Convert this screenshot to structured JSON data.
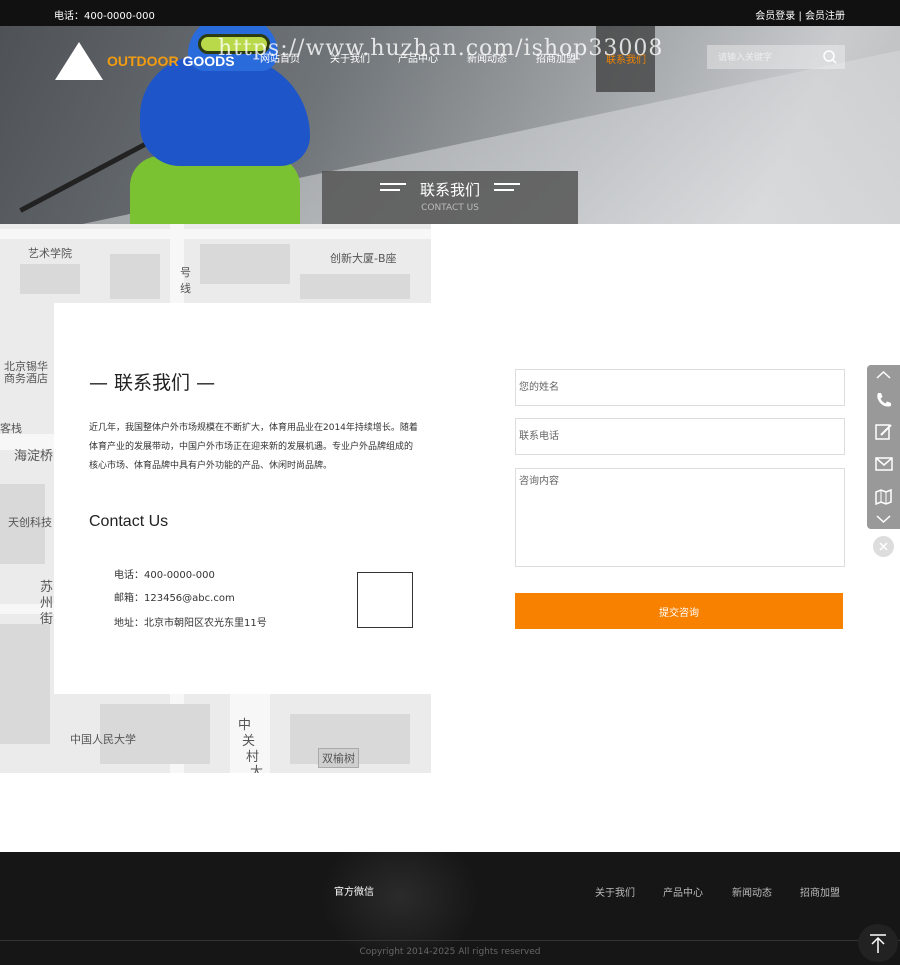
{
  "topbar": {
    "phone": "电话：400-0000-000",
    "login": "会员登录",
    "sep": "|",
    "register": "会员注册"
  },
  "brand": {
    "word1": "OUTDOOR",
    "word2": "GOODS"
  },
  "nav": {
    "items": [
      "网站首页",
      "关于我们",
      "产品中心",
      "新闻动态",
      "招商加盟"
    ],
    "active": "联系我们"
  },
  "watermark": "https://www.huzhan.com/ishop33008",
  "search": {
    "placeholder": "请输入关键字"
  },
  "hero": {
    "title": "联系我们",
    "subtitle": "CONTACT US"
  },
  "map": {
    "labels": [
      "艺术学院",
      "创新大厦-B座",
      "北京锡华",
      "商务酒店",
      "客栈",
      "海淀桥",
      "天创科技",
      "苏",
      "州",
      "街",
      "中国人民大学",
      "中",
      "关",
      "村",
      "大",
      "双榆树",
      "号",
      "线"
    ]
  },
  "contact": {
    "heading": "— 联系我们 —",
    "intro": "近几年，我国整体户外市场规模在不断扩大，体育用品业在2014年持续增长。随着体育产业的发展带动，中国户外市场正在迎来新的发展机遇。专业户外品牌组成的核心市场、体育品牌中具有户外功能的产品、休闲时尚品牌。",
    "en_heading": "Contact Us",
    "phone": "电话：400-0000-000",
    "email": "邮箱：123456@abc.com",
    "address": "地址：北京市朝阳区农光东里11号"
  },
  "form": {
    "name_placeholder": "您的姓名",
    "phone_placeholder": "联系电话",
    "message_placeholder": "咨询内容",
    "submit_label": "提交咨询"
  },
  "footer": {
    "wechat": "官方微信",
    "links": [
      "关于我们",
      "产品中心",
      "新闻动态",
      "招商加盟"
    ],
    "copyright": "Copyright 2014-2025     All rights reserved"
  },
  "colors": {
    "accent": "#f98100",
    "topbar": "#111111",
    "footer": "#161616"
  }
}
